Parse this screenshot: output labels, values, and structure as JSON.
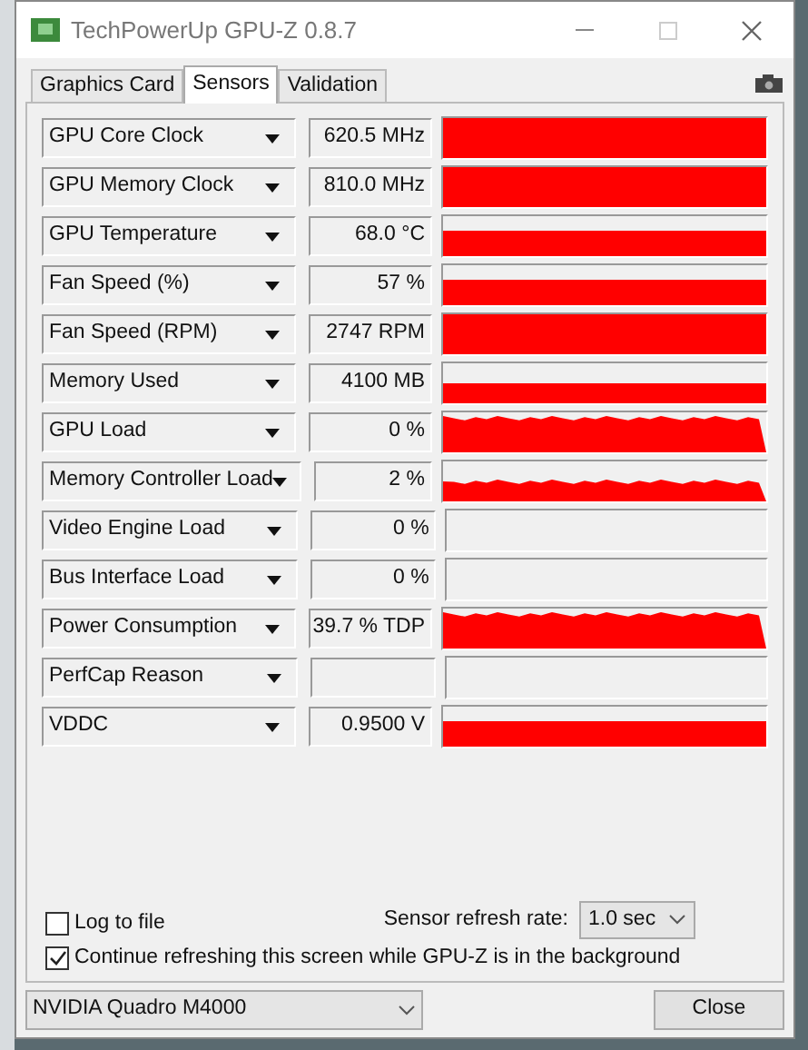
{
  "window": {
    "title": "TechPowerUp GPU-Z 0.8.7"
  },
  "tabs": [
    {
      "label": "Graphics Card",
      "selected": false
    },
    {
      "label": "Sensors",
      "selected": true
    },
    {
      "label": "Validation",
      "selected": false
    }
  ],
  "sensors": [
    {
      "name": "GPU Core Clock",
      "value": "620.5 MHz",
      "kind": "full"
    },
    {
      "name": "GPU Memory Clock",
      "value": "810.0 MHz",
      "kind": "full"
    },
    {
      "name": "GPU Temperature",
      "value": "68.0 °C",
      "kind": "high"
    },
    {
      "name": "Fan Speed (%)",
      "value": "57 %",
      "kind": "high"
    },
    {
      "name": "Fan Speed (RPM)",
      "value": "2747 RPM",
      "kind": "full"
    },
    {
      "name": "Memory Used",
      "value": "4100 MB",
      "kind": "low"
    },
    {
      "name": "GPU Load",
      "value": "0 %",
      "kind": "noisy"
    },
    {
      "name": "Memory Controller Load",
      "value": "2 %",
      "kind": "ragged"
    },
    {
      "name": "Video Engine Load",
      "value": "0 %",
      "kind": "empty"
    },
    {
      "name": "Bus Interface Load",
      "value": "0 %",
      "kind": "empty"
    },
    {
      "name": "Power Consumption",
      "value": "39.7 % TDP",
      "kind": "noisy"
    },
    {
      "name": "PerfCap Reason",
      "kind": "empty"
    },
    {
      "name": "VDDC",
      "value": "0.9500 V",
      "kind": "high"
    }
  ],
  "log_to_file": {
    "label": "Log to file",
    "checked": false
  },
  "refresh_rate": {
    "label": "Sensor refresh rate:",
    "value": "1.0 sec"
  },
  "continue_refreshing": {
    "label": "Continue refreshing this screen while GPU-Z is in the background",
    "checked": true
  },
  "gpu_select": {
    "value": "NVIDIA Quadro M4000"
  },
  "close_button": {
    "label": "Close"
  }
}
